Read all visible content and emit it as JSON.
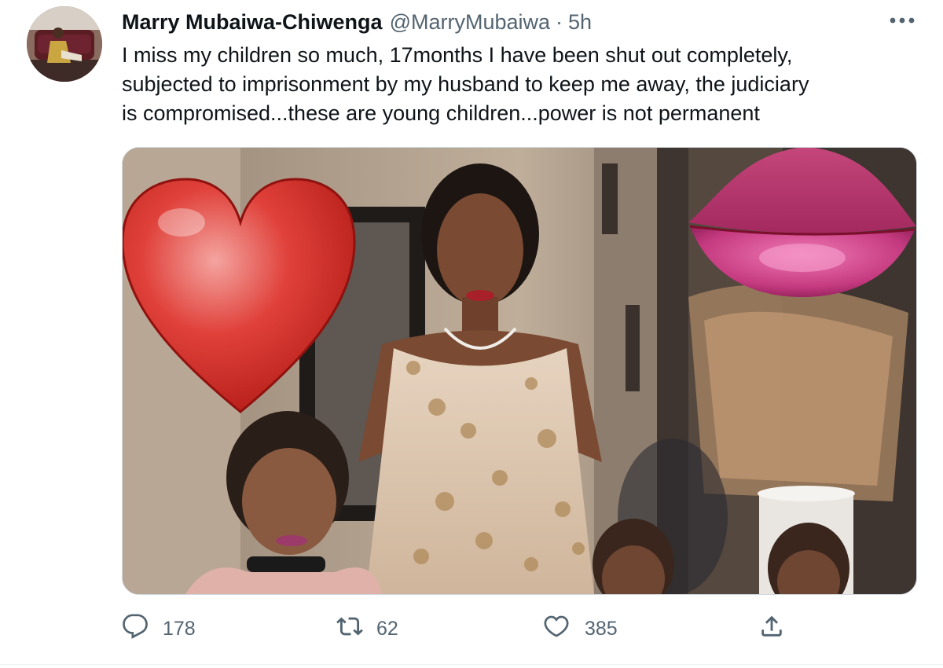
{
  "tweet": {
    "author_name": "Marry Mubaiwa-Chiwenga",
    "author_handle": "@MarryMubaiwa",
    "separator": "·",
    "timestamp": "5h",
    "more_icon": "more-horizontal-icon",
    "text_lines": [
      "I miss my children so much, 17months I have been shut out completely,",
      "subjected to imprisonment by my husband to keep me away, the judiciary",
      "is compromised...these are young children...power is not permanent"
    ]
  },
  "actions": {
    "reply": {
      "icon": "reply-icon",
      "count": "178"
    },
    "retweet": {
      "icon": "retweet-icon",
      "count": "62"
    },
    "like": {
      "icon": "heart-icon",
      "count": "385"
    },
    "share": {
      "icon": "share-icon"
    }
  },
  "media": {
    "stickers": [
      "red-heart-emoji",
      "lips-emoji"
    ]
  },
  "colors": {
    "text_primary": "#0f1419",
    "text_secondary": "#536471",
    "border": "#cfd9de"
  }
}
